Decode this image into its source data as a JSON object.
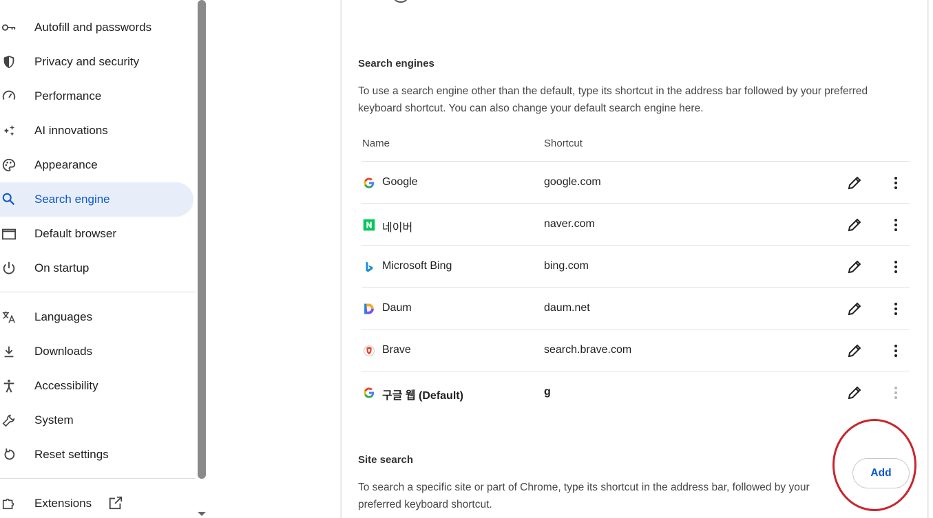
{
  "sidebar": {
    "items": [
      {
        "label": "Autofill and passwords",
        "icon": "key-icon"
      },
      {
        "label": "Privacy and security",
        "icon": "shield-icon"
      },
      {
        "label": "Performance",
        "icon": "speedometer-icon"
      },
      {
        "label": "AI innovations",
        "icon": "sparkle-icon"
      },
      {
        "label": "Appearance",
        "icon": "palette-icon"
      },
      {
        "label": "Search engine",
        "icon": "search-icon",
        "active": true
      },
      {
        "label": "Default browser",
        "icon": "browser-window-icon"
      },
      {
        "label": "On startup",
        "icon": "power-icon"
      },
      {
        "label": "Languages",
        "icon": "translate-icon"
      },
      {
        "label": "Downloads",
        "icon": "download-icon"
      },
      {
        "label": "Accessibility",
        "icon": "accessibility-icon"
      },
      {
        "label": "System",
        "icon": "wrench-icon"
      },
      {
        "label": "Reset settings",
        "icon": "reset-icon"
      },
      {
        "label": "Extensions",
        "icon": "puzzle-icon"
      }
    ]
  },
  "search_engines": {
    "title": "Search engines",
    "description": "To use a search engine other than the default, type its shortcut in the address bar followed by your preferred keyboard shortcut. You can also change your default search engine here.",
    "columns": {
      "name": "Name",
      "shortcut": "Shortcut"
    },
    "rows": [
      {
        "name": "Google",
        "shortcut": "google.com",
        "icon": "google-icon"
      },
      {
        "name": "네이버",
        "shortcut": "naver.com",
        "icon": "naver-icon"
      },
      {
        "name": "Microsoft Bing",
        "shortcut": "bing.com",
        "icon": "bing-icon"
      },
      {
        "name": "Daum",
        "shortcut": "daum.net",
        "icon": "daum-icon"
      },
      {
        "name": "Brave",
        "shortcut": "search.brave.com",
        "icon": "brave-icon"
      },
      {
        "name": "구글 웹 (Default)",
        "shortcut": "g",
        "icon": "google-icon",
        "default": true
      }
    ]
  },
  "site_search": {
    "title": "Site search",
    "description": "To search a specific site or part of Chrome, type its shortcut in the address bar, followed by your preferred keyboard shortcut.",
    "add_label": "Add"
  },
  "colors": {
    "accent": "#0b57d0",
    "active_bg": "#e8eef9",
    "annotation": "#c9252c"
  }
}
